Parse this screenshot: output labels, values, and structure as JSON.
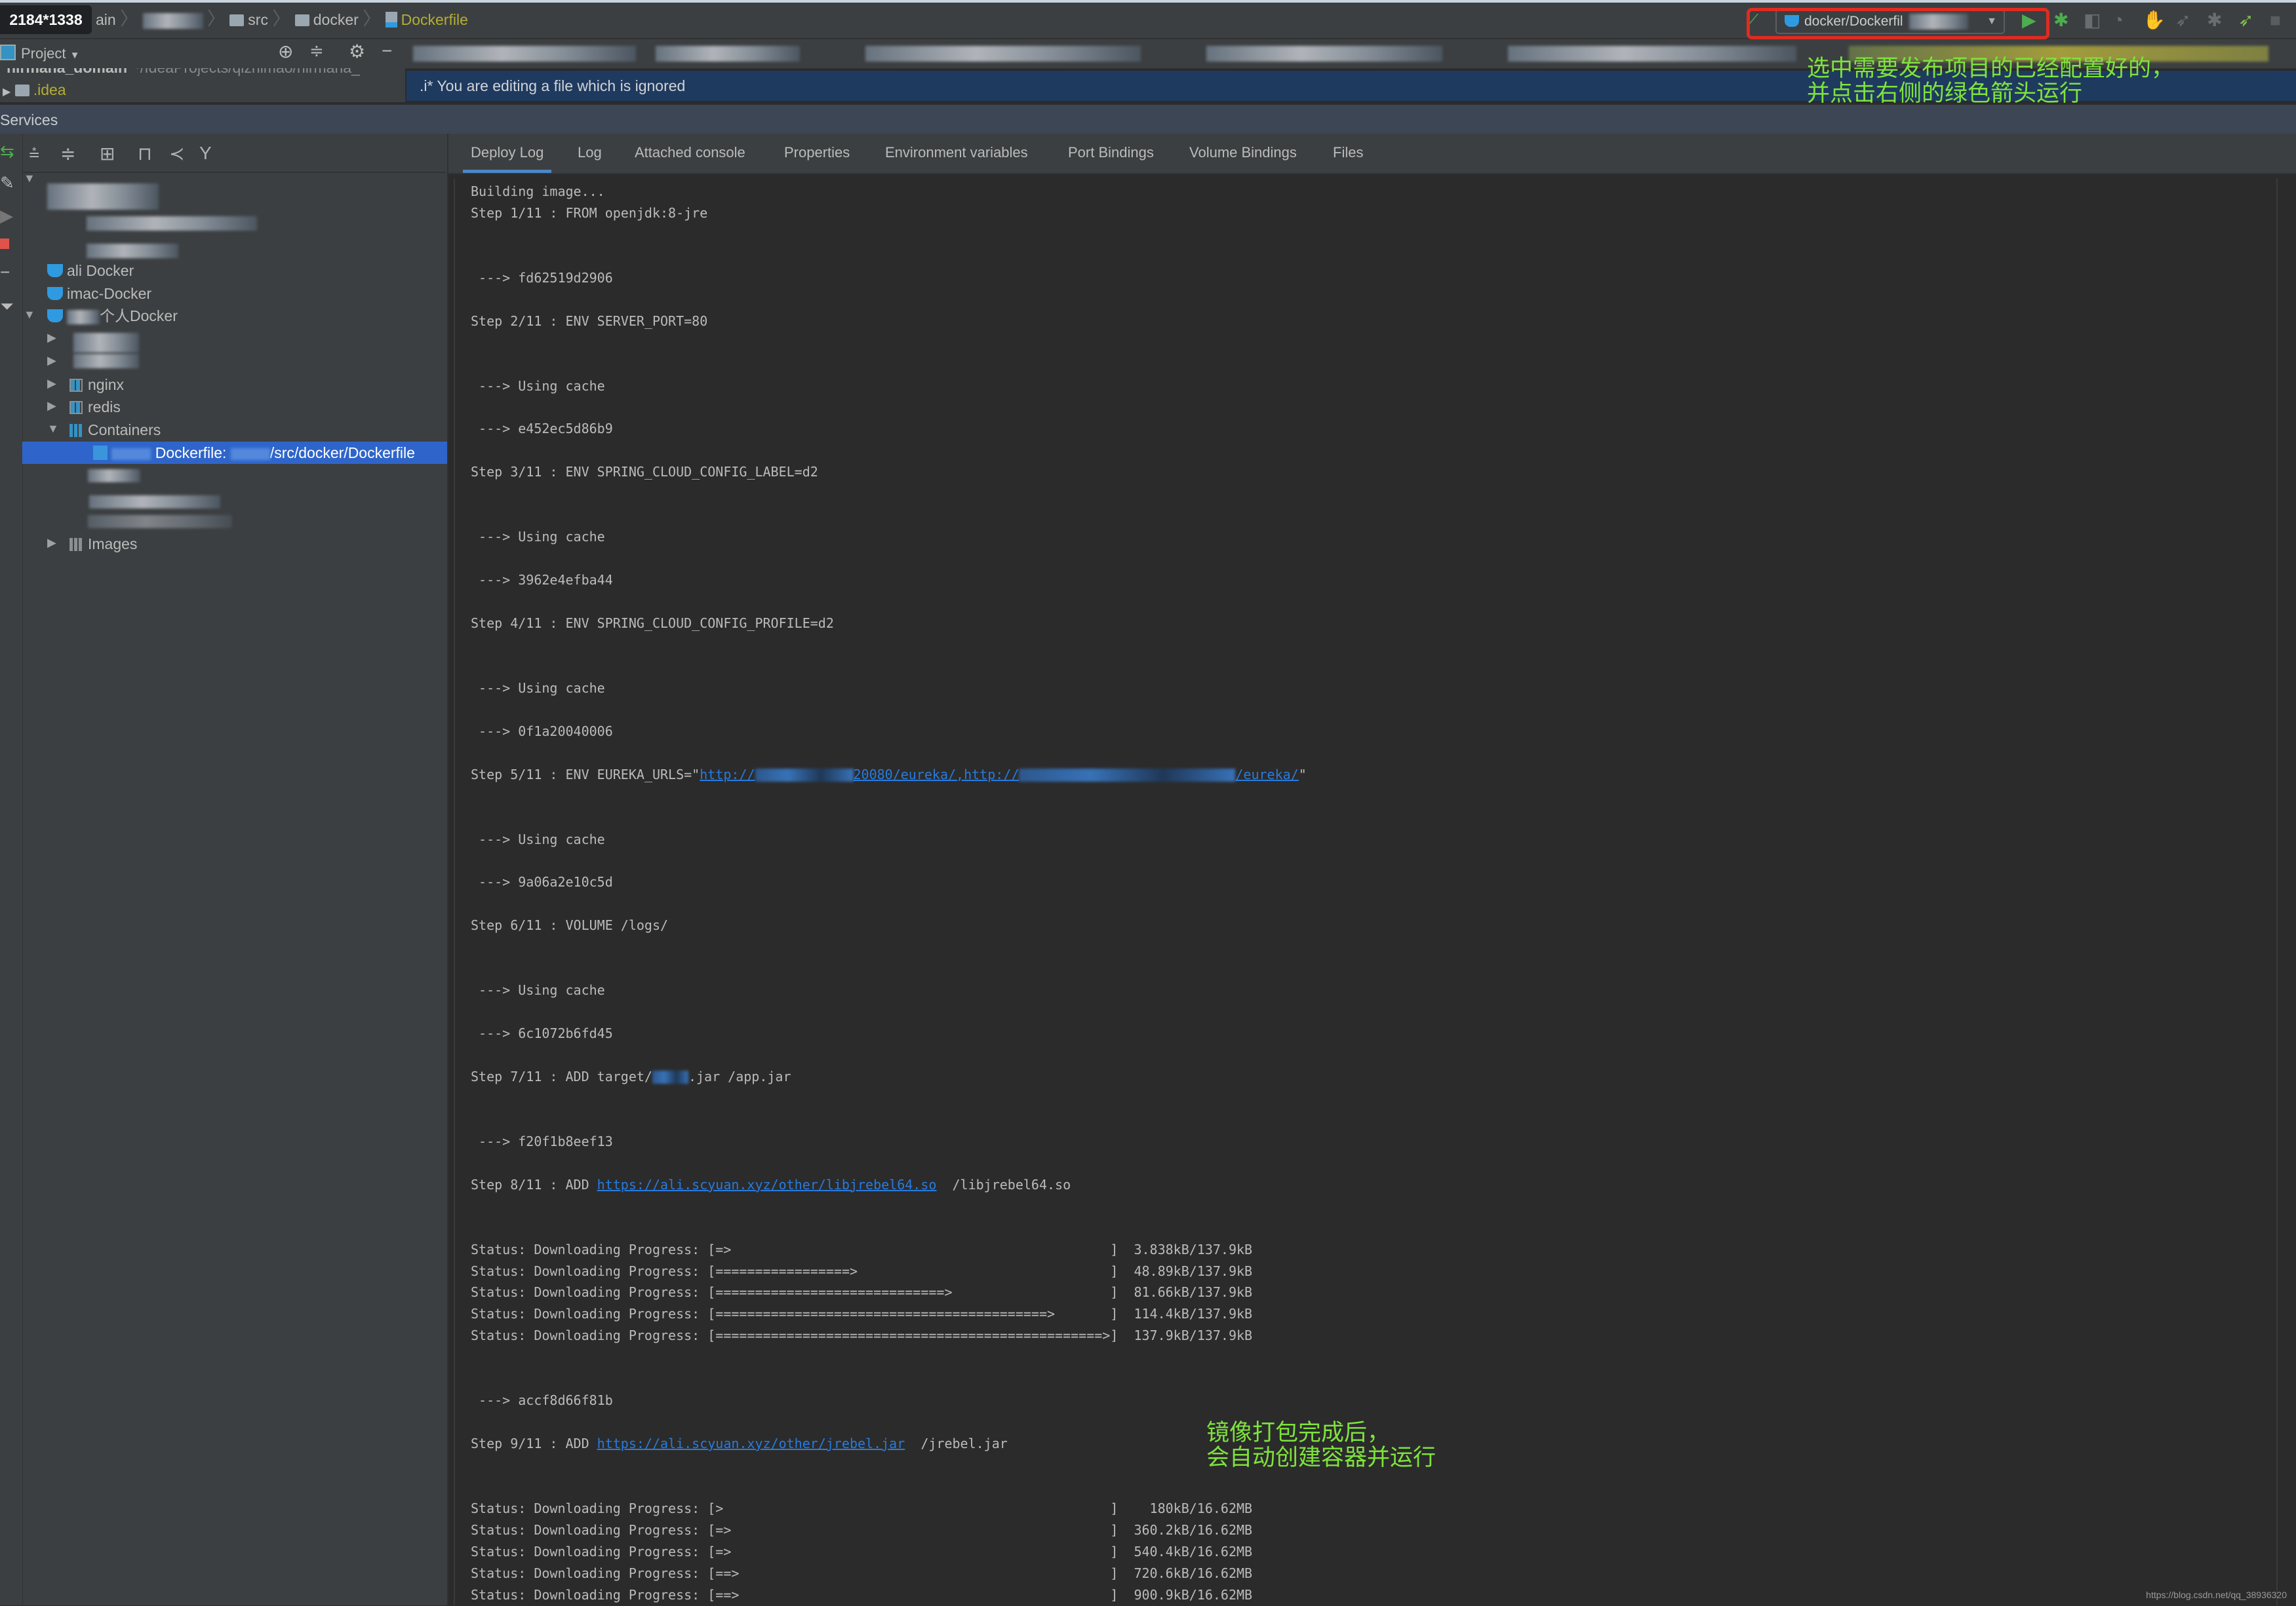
{
  "overlay_badge": "2184*1338",
  "breadcrumb": {
    "first": "ain",
    "items": [
      "src",
      "docker"
    ],
    "file": "Dockerfile"
  },
  "run_config": {
    "label": "docker/Dockerfil",
    "file_color": "#b3ae34",
    "run_color": "#4cae4f"
  },
  "project_panel": {
    "title": "Project",
    "root_name": "nirmana_domain",
    "root_path": "~/IdeaProjects/qizhimao/nirmana_",
    "idea_folder": ".idea"
  },
  "editor_banner": ".i* You are editing a file which is ignored",
  "services": {
    "title": "Services",
    "tree": {
      "ali_docker": "ali Docker",
      "imac_docker": "imac-Docker",
      "personal_docker": "个人Docker",
      "nginx": "nginx",
      "redis": "redis",
      "containers": "Containers",
      "selected_item": {
        "label": "Dockerfile:",
        "path": "/src/docker/Dockerfile"
      },
      "images": "Images"
    }
  },
  "tabs": [
    {
      "label": "Deploy Log",
      "active": true
    },
    {
      "label": "Log"
    },
    {
      "label": "Attached console"
    },
    {
      "label": "Properties"
    },
    {
      "label": "Environment variables"
    },
    {
      "label": "Port Bindings"
    },
    {
      "label": "Volume Bindings"
    },
    {
      "label": "Files"
    }
  ],
  "log": {
    "progress_prefix": "Status: Downloading Progress: [",
    "link_color": "#287bde",
    "lines": [
      {
        "text": "Building image..."
      },
      {
        "text": "Step 1/11 : FROM openjdk:8-jre"
      },
      {
        "text": ""
      },
      {
        "text": ""
      },
      {
        "text": " ---> fd62519d2906"
      },
      {
        "text": ""
      },
      {
        "text": "Step 2/11 : ENV SERVER_PORT=80"
      },
      {
        "text": ""
      },
      {
        "text": ""
      },
      {
        "text": " ---> Using cache"
      },
      {
        "text": ""
      },
      {
        "text": " ---> e452ec5d86b9"
      },
      {
        "text": ""
      },
      {
        "text": "Step 3/11 : ENV SPRING_CLOUD_CONFIG_LABEL=d2"
      },
      {
        "text": ""
      },
      {
        "text": ""
      },
      {
        "text": " ---> Using cache"
      },
      {
        "text": ""
      },
      {
        "text": " ---> 3962e4efba44"
      },
      {
        "text": ""
      },
      {
        "text": "Step 4/11 : ENV SPRING_CLOUD_CONFIG_PROFILE=d2"
      },
      {
        "text": ""
      },
      {
        "text": ""
      },
      {
        "text": " ---> Using cache"
      },
      {
        "text": ""
      },
      {
        "text": " ---> 0f1a20040006"
      },
      {
        "text": ""
      },
      {
        "pre": "Step 5/11 : ENV EUREKA_URLS=\"",
        "segs": [
          {
            "link": "http://"
          },
          {
            "redacted": true
          },
          {
            "link": "20080/eureka/,http://"
          },
          {
            "redacted": true
          },
          {
            "link": "/eureka/"
          }
        ],
        "post": "\""
      },
      {
        "text": ""
      },
      {
        "text": ""
      },
      {
        "text": " ---> Using cache"
      },
      {
        "text": ""
      },
      {
        "text": " ---> 9a06a2e10c5d"
      },
      {
        "text": ""
      },
      {
        "text": "Step 6/11 : VOLUME /logs/"
      },
      {
        "text": ""
      },
      {
        "text": ""
      },
      {
        "text": " ---> Using cache"
      },
      {
        "text": ""
      },
      {
        "text": " ---> 6c1072b6fd45"
      },
      {
        "text": ""
      },
      {
        "pre": "Step 7/11 : ADD target/",
        "segs": [
          {
            "redacted": true
          }
        ],
        "post": ".jar /app.jar"
      },
      {
        "text": ""
      },
      {
        "text": ""
      },
      {
        "text": " ---> f20f1b8eef13"
      },
      {
        "text": ""
      },
      {
        "pre": "Step 8/11 : ADD ",
        "segs": [
          {
            "link": "https://ali.scyuan.xyz/other/libjrebel64.so"
          }
        ],
        "post": "  /libjrebel64.so"
      },
      {
        "text": ""
      },
      {
        "text": ""
      },
      {
        "bar": "=>",
        "tail": "]  3.838kB/137.9kB"
      },
      {
        "bar": "=================>",
        "tail": "]  48.89kB/137.9kB"
      },
      {
        "bar": "=============================>",
        "tail": "]  81.66kB/137.9kB"
      },
      {
        "bar": "==========================================>",
        "tail": "]  114.4kB/137.9kB"
      },
      {
        "bar": "=================================================>",
        "tail": "]  137.9kB/137.9kB"
      },
      {
        "text": ""
      },
      {
        "text": ""
      },
      {
        "text": " ---> accf8d66f81b"
      },
      {
        "text": ""
      },
      {
        "pre": "Step 9/11 : ADD ",
        "segs": [
          {
            "link": "https://ali.scyuan.xyz/other/jrebel.jar"
          }
        ],
        "post": "  /jrebel.jar"
      },
      {
        "text": ""
      },
      {
        "text": ""
      },
      {
        "bar": ">",
        "tail": "]    180kB/16.62MB"
      },
      {
        "bar": "=>",
        "tail": "]  360.2kB/16.62MB"
      },
      {
        "bar": "=>",
        "tail": "]  540.4kB/16.62MB"
      },
      {
        "bar": "==>",
        "tail": "]  720.6kB/16.62MB"
      },
      {
        "bar": "==>",
        "tail": "]  900.9kB/16.62MB"
      }
    ]
  },
  "annotations": {
    "top": [
      "选中需要发布项目的已经配置好的，",
      "并点击右侧的绿色箭头运行"
    ],
    "bottom": [
      "镜像打包完成后，",
      "会自动创建容器并运行"
    ],
    "color": "#7ee33c"
  },
  "watermark": "https://blog.csdn.net/qq_38936320"
}
